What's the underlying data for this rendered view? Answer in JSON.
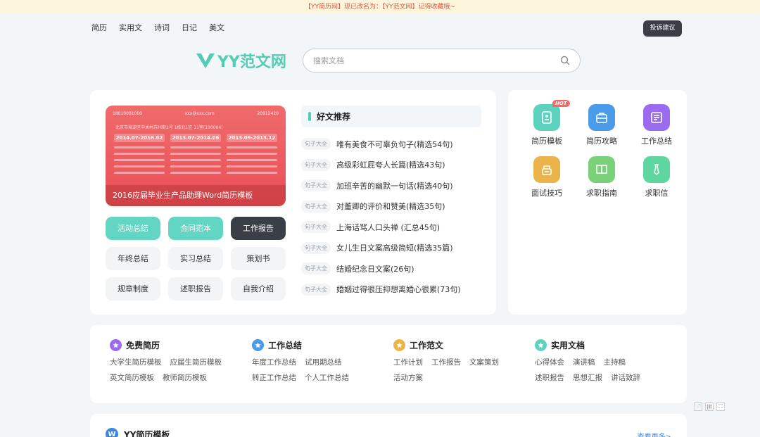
{
  "notice": "【YY简历网】现已改名为：【YY范文网】记得收藏哦~",
  "topnav": [
    "简历",
    "实用文",
    "诗词",
    "日记",
    "美文"
  ],
  "complain_label": "投诉建议",
  "logo_text": "YY范文网",
  "search": {
    "placeholder": "搜索文档"
  },
  "banner": {
    "phone": "18010001000",
    "email": "xxx@xxx.com",
    "qq": "20912420",
    "address": "北京市海淀区中关村苏州街1号 1栋北1区 11室(100084)",
    "periods": [
      "2014.07-2016.02",
      "2013.07-2014.06",
      "2013.09-2013.12"
    ],
    "caption": "2016应届毕业生产品助理Word简历模板"
  },
  "tags": [
    {
      "label": "活动总结",
      "style": "teal"
    },
    {
      "label": "合同范本",
      "style": "teal"
    },
    {
      "label": "工作报告",
      "style": "dark"
    },
    {
      "label": "年终总结",
      "style": "plain"
    },
    {
      "label": "实习总结",
      "style": "plain"
    },
    {
      "label": "策划书",
      "style": "plain"
    },
    {
      "label": "规章制度",
      "style": "plain"
    },
    {
      "label": "述职报告",
      "style": "plain"
    },
    {
      "label": "自我介绍",
      "style": "plain"
    }
  ],
  "recommend": {
    "title": "好文推荐",
    "items": [
      {
        "badge": "句子大全",
        "text": "唯有美食不可辜负句子(精选54句)"
      },
      {
        "badge": "句子大全",
        "text": "高级彩虹屁夸人长篇(精选43句)"
      },
      {
        "badge": "句子大全",
        "text": "加班辛苦的幽默一句话(精选40句)"
      },
      {
        "badge": "句子大全",
        "text": "对董卿的评价和赞美(精选35句)"
      },
      {
        "badge": "句子大全",
        "text": "上海话骂人口头禅 (汇总45句)"
      },
      {
        "badge": "句子大全",
        "text": "女儿生日文案高级简短(精选35篇)"
      },
      {
        "badge": "句子大全",
        "text": "结婚纪念日文案(26句)"
      },
      {
        "badge": "句子大全",
        "text": "婚姻过得很压抑想离婚心很累(73句)"
      }
    ]
  },
  "quick": [
    {
      "label": "简历模板",
      "icon": "resume-icon",
      "color": "#5dd3bf",
      "hot": "HOT"
    },
    {
      "label": "简历攻略",
      "icon": "briefcase-icon",
      "color": "#4a9be8"
    },
    {
      "label": "工作总结",
      "icon": "report-icon",
      "color": "#9b6cf0"
    },
    {
      "label": "面试技巧",
      "icon": "interview-icon",
      "color": "#eab44a"
    },
    {
      "label": "求职指南",
      "icon": "book-icon",
      "color": "#7bd07a"
    },
    {
      "label": "求职信",
      "icon": "tie-icon",
      "color": "#5fd6a0"
    }
  ],
  "categories": [
    {
      "title": "免费简历",
      "color": "#9b6cf0",
      "rows": [
        [
          "大学生简历模板",
          "应届生简历模板"
        ],
        [
          "英文简历模板",
          "教师简历模板"
        ]
      ]
    },
    {
      "title": "工作总结",
      "color": "#4a9be8",
      "rows": [
        [
          "年度工作总结",
          "试用期总结"
        ],
        [
          "转正工作总结",
          "个人工作总结"
        ]
      ]
    },
    {
      "title": "工作范文",
      "color": "#eab44a",
      "rows": [
        [
          "工作计划",
          "工作报告",
          "文案策划"
        ],
        [
          "活动方案"
        ]
      ]
    },
    {
      "title": "实用文档",
      "color": "#5dd3bf",
      "rows": [
        [
          "心得体会",
          "演讲稿",
          "主持稿"
        ],
        [
          "述职报告",
          "思想汇报",
          "讲话致辞"
        ]
      ]
    }
  ],
  "bottom": {
    "badge": "W",
    "title": "YY简历模板",
    "more": "查看更多>"
  },
  "float_tools": [
    "📄",
    "拼",
    "⛶"
  ]
}
